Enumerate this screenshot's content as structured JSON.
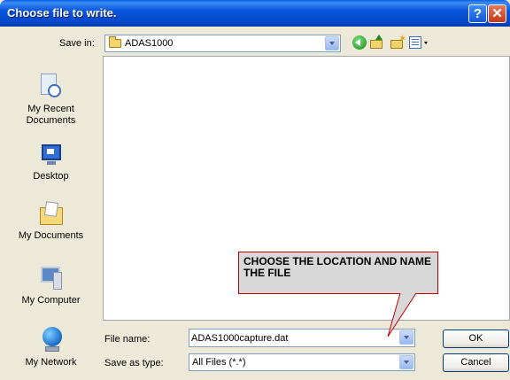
{
  "window": {
    "title": "Choose file to write."
  },
  "toolbar": {
    "save_in_label": "Save in:",
    "save_in_value": "ADAS1000",
    "icons": [
      "back-icon",
      "up-folder-icon",
      "new-folder-icon",
      "views-menu-icon"
    ]
  },
  "places": [
    {
      "id": "recent",
      "label": "My Recent Documents",
      "icon": "recent-documents-icon"
    },
    {
      "id": "desktop",
      "label": "Desktop",
      "icon": "desktop-icon"
    },
    {
      "id": "mydocs",
      "label": "My Documents",
      "icon": "my-documents-icon"
    },
    {
      "id": "mycomputer",
      "label": "My Computer",
      "icon": "my-computer-icon"
    },
    {
      "id": "mynetwork",
      "label": "My Network",
      "icon": "my-network-icon"
    }
  ],
  "form": {
    "file_name_label": "File name:",
    "file_name_value": "ADAS1000capture.dat",
    "save_as_label": "Save as type:",
    "save_as_value": "All Files (*.*)"
  },
  "buttons": {
    "ok": "OK",
    "cancel": "Cancel"
  },
  "callout": {
    "text": "CHOOSE THE LOCATION AND NAME THE FILE",
    "border_color": "#c00000"
  },
  "colors": {
    "titlebar": "#0a56de",
    "dialog_bg": "#ece9d8"
  }
}
